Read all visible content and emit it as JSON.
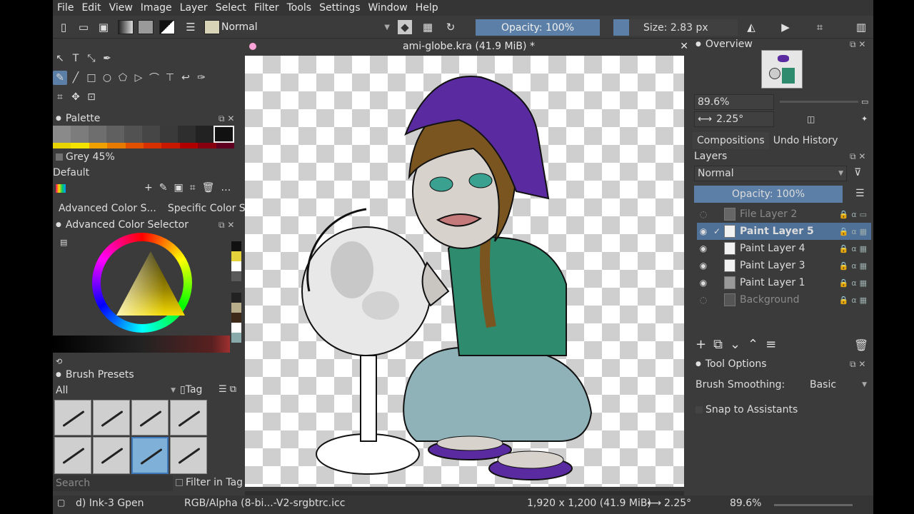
{
  "menu": [
    "File",
    "Edit",
    "View",
    "Image",
    "Layer",
    "Select",
    "Filter",
    "Tools",
    "Settings",
    "Window",
    "Help"
  ],
  "toolbar": {
    "blend_mode": "Normal",
    "opacity": "Opacity: 100%",
    "size": "Size: 2.83 px"
  },
  "document": {
    "tab_title": "ami-globe.kra (41.9 MiB) *"
  },
  "palette": {
    "title": "Palette",
    "selected_color": "Grey 45%",
    "palette_name": "Default",
    "swatches_row1": [
      "#8a8a8a",
      "#7c7c7c",
      "#6e6e6e",
      "#606060",
      "#525252",
      "#464646",
      "#3a3a3a",
      "#2e2e2e",
      "#222222",
      "#111111"
    ],
    "swatches_row2": [
      "#e8d400",
      "#f4e300",
      "#f0a000",
      "#e87a00",
      "#e05000",
      "#d83000",
      "#c81800",
      "#b00000",
      "#880010",
      "#600020"
    ]
  },
  "color_tabs": [
    "Advanced Color S...",
    "Specific Color S..."
  ],
  "advanced_color": {
    "title": "Advanced Color Selector"
  },
  "brush_presets": {
    "title": "Brush Presets",
    "filter": "All",
    "tag_label": "Tag",
    "search_placeholder": "Search",
    "filter_in_tag": "Filter in Tag"
  },
  "overview": {
    "title": "Overview",
    "zoom": "89.6%",
    "rotation": "2.25°"
  },
  "right_tabs": [
    "Compositions",
    "Undo History"
  ],
  "layers": {
    "title": "Layers",
    "blend_mode": "Normal",
    "opacity": "Opacity:  100%",
    "items": [
      {
        "name": "File Layer 2",
        "visible": false,
        "selected": false
      },
      {
        "name": "Paint Layer 5",
        "visible": true,
        "selected": true
      },
      {
        "name": "Paint Layer 4",
        "visible": true,
        "selected": false
      },
      {
        "name": "Paint Layer 3",
        "visible": true,
        "selected": false
      },
      {
        "name": "Paint Layer 1",
        "visible": true,
        "selected": false
      },
      {
        "name": "Background",
        "visible": false,
        "selected": false
      }
    ]
  },
  "tool_options": {
    "title": "Tool Options",
    "brush_smoothing_label": "Brush Smoothing:",
    "brush_smoothing_value": "Basic",
    "snap_label": "Snap to Assistants"
  },
  "status": {
    "brush": "d) Ink-3 Gpen",
    "color_profile": "RGB/Alpha (8-bi...-V2-srgbtrc.icc",
    "dimensions": "1,920 x 1,200 (41.9 MiB)",
    "rotation": "2.25°",
    "zoom": "89.6%"
  }
}
